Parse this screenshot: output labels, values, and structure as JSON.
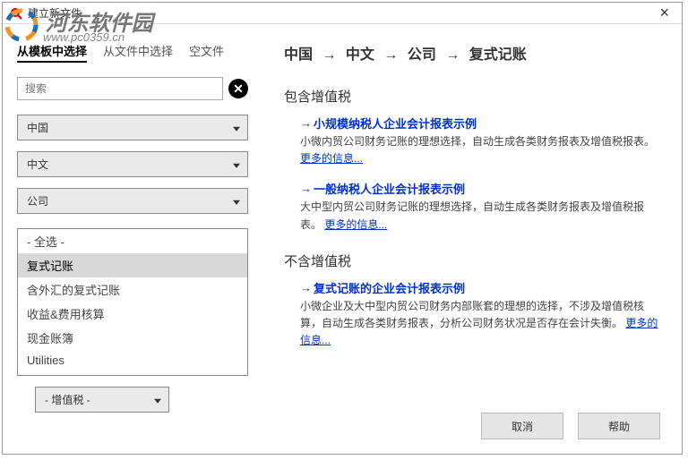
{
  "watermark": {
    "text": "河东软件园",
    "url": "www.pc0359.cn"
  },
  "window": {
    "title": "建立新文件"
  },
  "tabs": {
    "t1": "从模板中选择",
    "t2": "从文件中选择",
    "t3": "空文件"
  },
  "search": {
    "placeholder": "搜索"
  },
  "dropdowns": {
    "country": "中国",
    "language": "中文",
    "category": "公司",
    "vat": "- 增值税 -"
  },
  "listItems": {
    "i0": "- 全选 -",
    "i1": "复式记账",
    "i2": "含外汇的复式记账",
    "i3": "收益&费用核算",
    "i4": "现金账簿",
    "i5": "Utilities"
  },
  "breadcrumb": {
    "p1": "中国",
    "p2": "中文",
    "p3": "公司",
    "p4": "复式记账"
  },
  "sections": {
    "s1": "包含增值税",
    "s2": "不含增值税"
  },
  "templates": {
    "a": {
      "title": "小规模纳税人企业会计报表示例",
      "desc": "小微内贸公司财务记账的理想选择，自动生成各类财务报表及增值税报表。",
      "more": "更多的信息..."
    },
    "b": {
      "title": "一般纳税人企业会计报表示例",
      "desc": "大中型内贸公司财务记账的理想选择，自动生成各类财务报表及增值税报表。",
      "more": "更多的信息..."
    },
    "c": {
      "title": "复式记账的企业会计报表示例",
      "desc": "小微企业及大中型内贸公司财务内部账套的理想的选择，不涉及增值税核算，自动生成各类财务报表，分析公司财务状况是否存在会计失衡。",
      "more": "更多的信息..."
    }
  },
  "buttons": {
    "cancel": "取消",
    "help": "帮助"
  }
}
